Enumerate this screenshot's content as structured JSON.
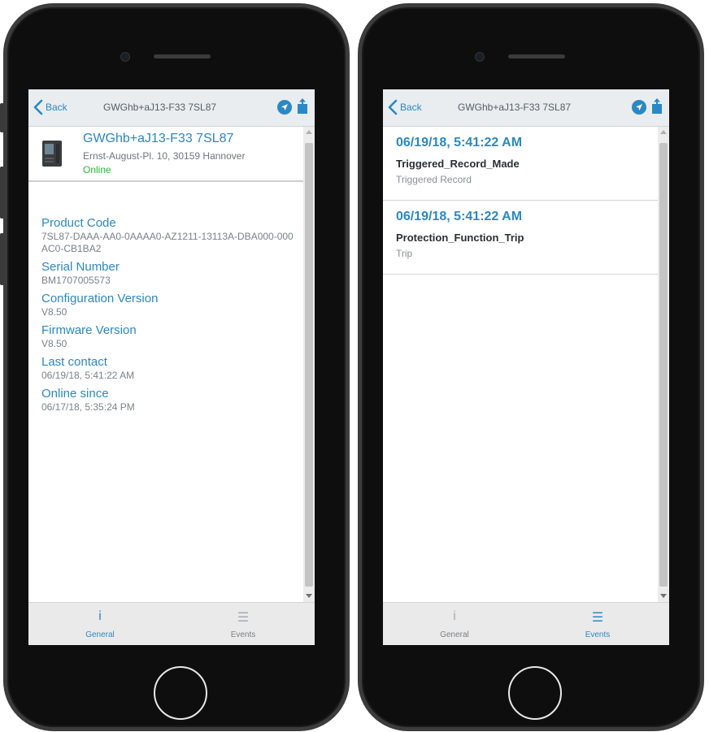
{
  "left_phone": {
    "nav": {
      "back_label": "Back",
      "title": "GWGhb+aJ13-F33 7SL87"
    },
    "device": {
      "name": "GWGhb+aJ13-F33 7SL87",
      "address": "Ernst-August-Pl. 10, 30159 Hannover",
      "status": "Online",
      "status_color": "#2fb52f"
    },
    "properties": [
      {
        "label": "Product Code",
        "value": "7SL87-DAAA-AA0-0AAAA0-AZ1211-13113A-DBA000-000AC0-CB1BA2"
      },
      {
        "label": "Serial Number",
        "value": "BM1707005573"
      },
      {
        "label": "Configuration Version",
        "value": "V8.50"
      },
      {
        "label": "Firmware Version",
        "value": "V8.50"
      },
      {
        "label": "Last contact",
        "value": "06/19/18, 5:41:22 AM"
      },
      {
        "label": "Online since",
        "value": "06/17/18, 5:35:24 PM"
      }
    ],
    "tabs": [
      {
        "label": "General",
        "icon": "info-icon",
        "active": true
      },
      {
        "label": "Events",
        "icon": "list-icon",
        "active": false
      }
    ]
  },
  "right_phone": {
    "nav": {
      "back_label": "Back",
      "title": "GWGhb+aJ13-F33 7SL87"
    },
    "events": [
      {
        "time": "06/19/18, 5:41:22 AM",
        "name": "Triggered_Record_Made",
        "type": "Triggered Record"
      },
      {
        "time": "06/19/18, 5:41:22 AM",
        "name": "Protection_Function_Trip",
        "type": "Trip"
      }
    ],
    "tabs": [
      {
        "label": "General",
        "icon": "info-icon",
        "active": false
      },
      {
        "label": "Events",
        "icon": "list-icon",
        "active": true
      }
    ]
  },
  "colors": {
    "accent": "#2b88c4",
    "online": "#2fb52f",
    "navbar_bg": "#e9edf0"
  },
  "icons": {
    "tab_general": "i",
    "tab_events": "☰"
  }
}
